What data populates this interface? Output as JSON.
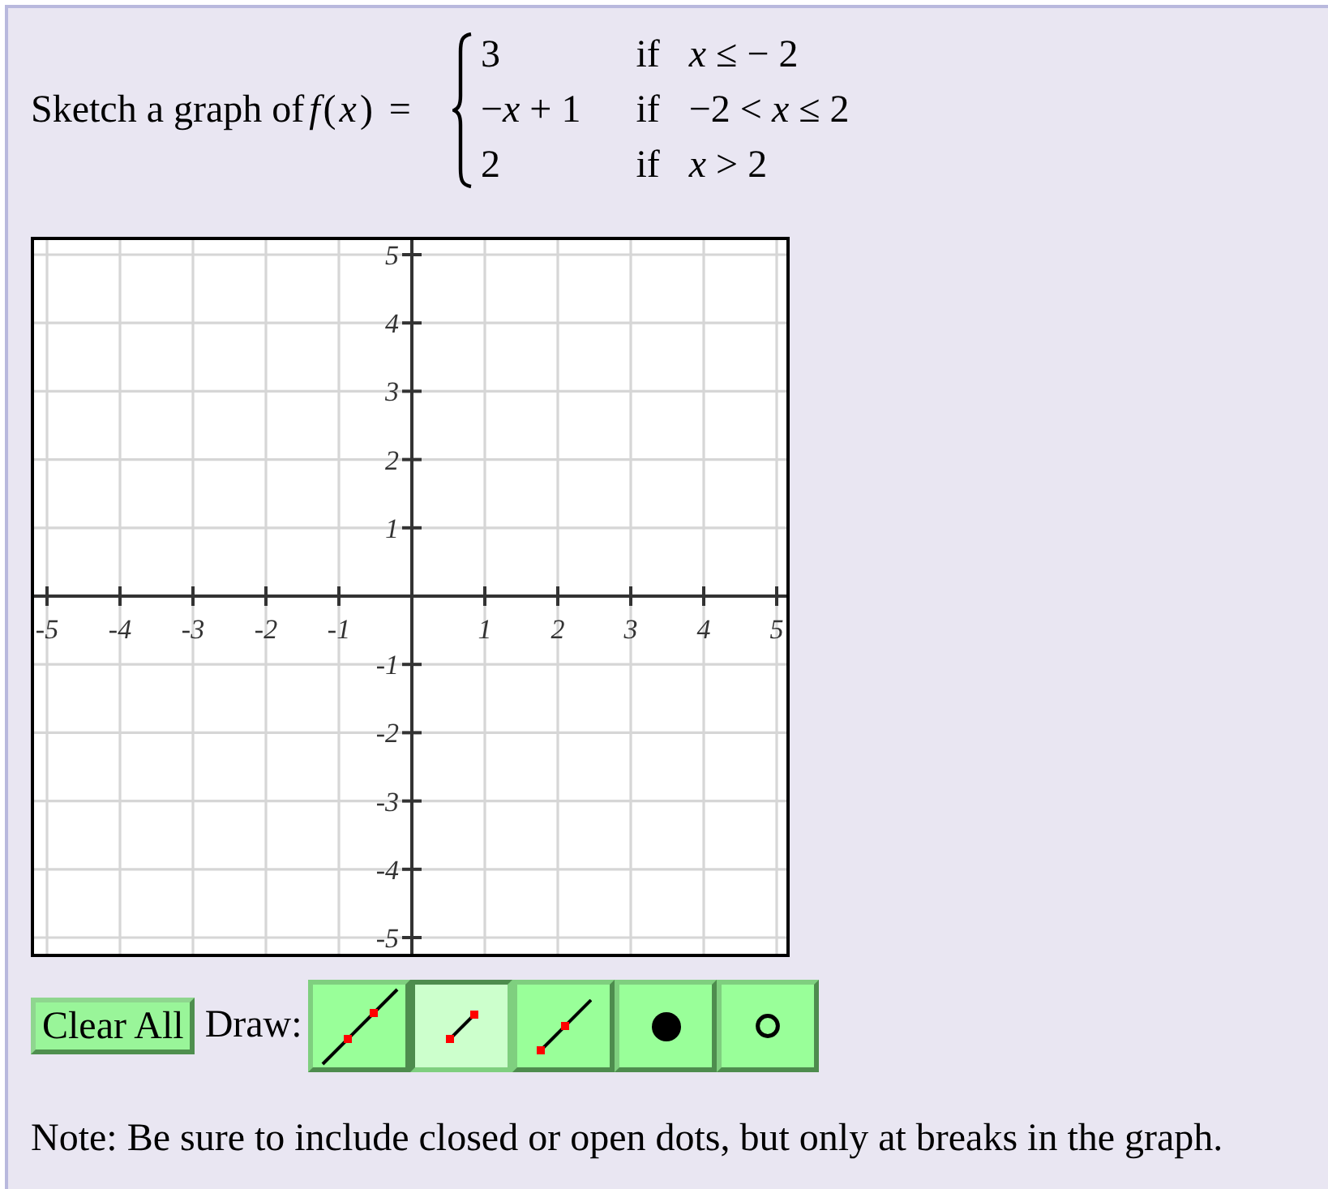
{
  "question": {
    "prompt": "Sketch a graph of",
    "function": "*f*(*x*) =",
    "cases": [
      {
        "value": "3",
        "keyword": "if",
        "condition": "*x* ≤ − 2"
      },
      {
        "value": "−*x* + 1",
        "keyword": "if",
        "condition": "−2 < *x* ≤ 2"
      },
      {
        "value": "2",
        "keyword": "if",
        "condition": "*x* > 2"
      }
    ]
  },
  "graph": {
    "x_tick_labels": [
      "-5",
      "-4",
      "-3",
      "-2",
      "-1",
      "1",
      "2",
      "3",
      "4",
      "5"
    ],
    "y_tick_labels": [
      "5",
      "4",
      "3",
      "2",
      "1",
      "-1",
      "-2",
      "-3",
      "-4",
      "-5"
    ]
  },
  "toolbar": {
    "clear_button": "Clear All",
    "draw_label": "Draw:",
    "tools": [
      {
        "kind": "line",
        "selected": false
      },
      {
        "kind": "segment",
        "selected": true
      },
      {
        "kind": "ray",
        "selected": false
      },
      {
        "kind": "closed-dot",
        "selected": false
      },
      {
        "kind": "open-dot",
        "selected": false
      }
    ]
  },
  "note": "Note: Be sure to include closed or open dots, but only at breaks in the graph."
}
